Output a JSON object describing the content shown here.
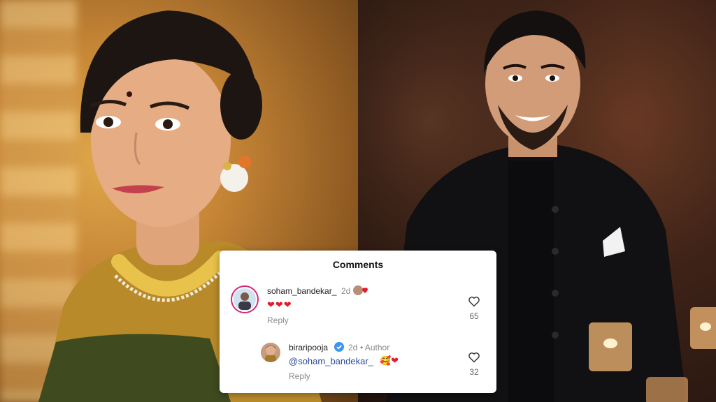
{
  "comments_panel": {
    "title": "Comments",
    "comments": [
      {
        "username": "soham_bandekar_",
        "time": "2d",
        "text": "❤❤❤",
        "reply_label": "Reply",
        "likes": "65"
      },
      {
        "username": "biraripooja",
        "time": "2d",
        "author_tag": "• Author",
        "mention": "@soham_bandekar_",
        "text_suffix": "🥰❤",
        "reply_label": "Reply",
        "likes": "32"
      }
    ]
  },
  "colors": {
    "heart_red": "#e8192c",
    "verified_blue": "#3897f0",
    "mention_blue": "#2c4b9a",
    "story_ring": "#d62976"
  },
  "icons": [
    "heart-outline-icon",
    "verified-badge-icon",
    "heart-emoji",
    "smiling-face-with-hearts-emoji"
  ]
}
